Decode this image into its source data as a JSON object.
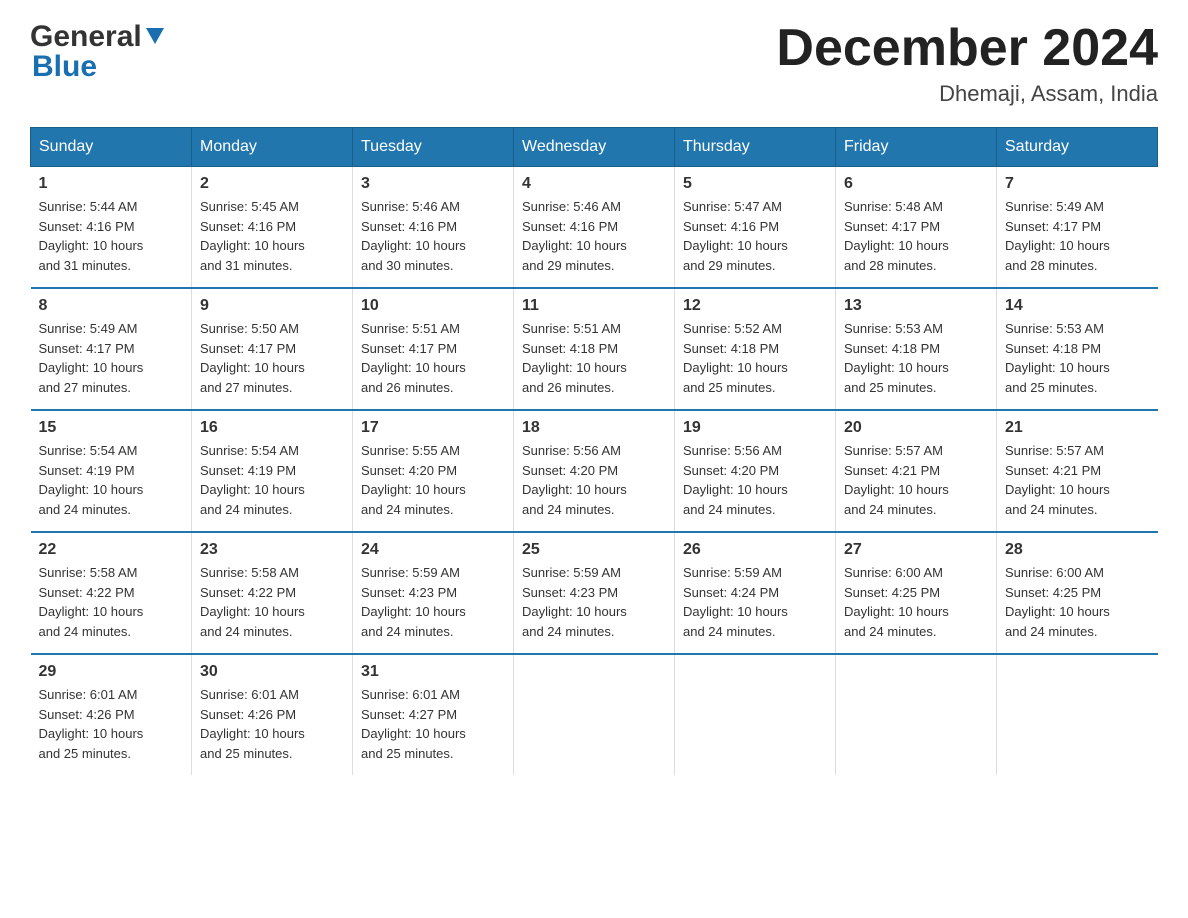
{
  "header": {
    "logo_general": "General",
    "logo_blue": "Blue",
    "month_title": "December 2024",
    "location": "Dhemaji, Assam, India"
  },
  "days_of_week": [
    "Sunday",
    "Monday",
    "Tuesday",
    "Wednesday",
    "Thursday",
    "Friday",
    "Saturday"
  ],
  "weeks": [
    [
      {
        "day": "1",
        "sunrise": "5:44 AM",
        "sunset": "4:16 PM",
        "daylight": "10 hours and 31 minutes."
      },
      {
        "day": "2",
        "sunrise": "5:45 AM",
        "sunset": "4:16 PM",
        "daylight": "10 hours and 31 minutes."
      },
      {
        "day": "3",
        "sunrise": "5:46 AM",
        "sunset": "4:16 PM",
        "daylight": "10 hours and 30 minutes."
      },
      {
        "day": "4",
        "sunrise": "5:46 AM",
        "sunset": "4:16 PM",
        "daylight": "10 hours and 29 minutes."
      },
      {
        "day": "5",
        "sunrise": "5:47 AM",
        "sunset": "4:16 PM",
        "daylight": "10 hours and 29 minutes."
      },
      {
        "day": "6",
        "sunrise": "5:48 AM",
        "sunset": "4:17 PM",
        "daylight": "10 hours and 28 minutes."
      },
      {
        "day": "7",
        "sunrise": "5:49 AM",
        "sunset": "4:17 PM",
        "daylight": "10 hours and 28 minutes."
      }
    ],
    [
      {
        "day": "8",
        "sunrise": "5:49 AM",
        "sunset": "4:17 PM",
        "daylight": "10 hours and 27 minutes."
      },
      {
        "day": "9",
        "sunrise": "5:50 AM",
        "sunset": "4:17 PM",
        "daylight": "10 hours and 27 minutes."
      },
      {
        "day": "10",
        "sunrise": "5:51 AM",
        "sunset": "4:17 PM",
        "daylight": "10 hours and 26 minutes."
      },
      {
        "day": "11",
        "sunrise": "5:51 AM",
        "sunset": "4:18 PM",
        "daylight": "10 hours and 26 minutes."
      },
      {
        "day": "12",
        "sunrise": "5:52 AM",
        "sunset": "4:18 PM",
        "daylight": "10 hours and 25 minutes."
      },
      {
        "day": "13",
        "sunrise": "5:53 AM",
        "sunset": "4:18 PM",
        "daylight": "10 hours and 25 minutes."
      },
      {
        "day": "14",
        "sunrise": "5:53 AM",
        "sunset": "4:18 PM",
        "daylight": "10 hours and 25 minutes."
      }
    ],
    [
      {
        "day": "15",
        "sunrise": "5:54 AM",
        "sunset": "4:19 PM",
        "daylight": "10 hours and 24 minutes."
      },
      {
        "day": "16",
        "sunrise": "5:54 AM",
        "sunset": "4:19 PM",
        "daylight": "10 hours and 24 minutes."
      },
      {
        "day": "17",
        "sunrise": "5:55 AM",
        "sunset": "4:20 PM",
        "daylight": "10 hours and 24 minutes."
      },
      {
        "day": "18",
        "sunrise": "5:56 AM",
        "sunset": "4:20 PM",
        "daylight": "10 hours and 24 minutes."
      },
      {
        "day": "19",
        "sunrise": "5:56 AM",
        "sunset": "4:20 PM",
        "daylight": "10 hours and 24 minutes."
      },
      {
        "day": "20",
        "sunrise": "5:57 AM",
        "sunset": "4:21 PM",
        "daylight": "10 hours and 24 minutes."
      },
      {
        "day": "21",
        "sunrise": "5:57 AM",
        "sunset": "4:21 PM",
        "daylight": "10 hours and 24 minutes."
      }
    ],
    [
      {
        "day": "22",
        "sunrise": "5:58 AM",
        "sunset": "4:22 PM",
        "daylight": "10 hours and 24 minutes."
      },
      {
        "day": "23",
        "sunrise": "5:58 AM",
        "sunset": "4:22 PM",
        "daylight": "10 hours and 24 minutes."
      },
      {
        "day": "24",
        "sunrise": "5:59 AM",
        "sunset": "4:23 PM",
        "daylight": "10 hours and 24 minutes."
      },
      {
        "day": "25",
        "sunrise": "5:59 AM",
        "sunset": "4:23 PM",
        "daylight": "10 hours and 24 minutes."
      },
      {
        "day": "26",
        "sunrise": "5:59 AM",
        "sunset": "4:24 PM",
        "daylight": "10 hours and 24 minutes."
      },
      {
        "day": "27",
        "sunrise": "6:00 AM",
        "sunset": "4:25 PM",
        "daylight": "10 hours and 24 minutes."
      },
      {
        "day": "28",
        "sunrise": "6:00 AM",
        "sunset": "4:25 PM",
        "daylight": "10 hours and 24 minutes."
      }
    ],
    [
      {
        "day": "29",
        "sunrise": "6:01 AM",
        "sunset": "4:26 PM",
        "daylight": "10 hours and 25 minutes."
      },
      {
        "day": "30",
        "sunrise": "6:01 AM",
        "sunset": "4:26 PM",
        "daylight": "10 hours and 25 minutes."
      },
      {
        "day": "31",
        "sunrise": "6:01 AM",
        "sunset": "4:27 PM",
        "daylight": "10 hours and 25 minutes."
      },
      null,
      null,
      null,
      null
    ]
  ],
  "labels": {
    "sunrise": "Sunrise:",
    "sunset": "Sunset:",
    "daylight": "Daylight:"
  }
}
